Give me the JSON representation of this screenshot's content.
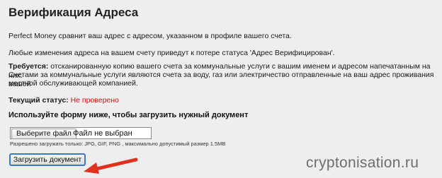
{
  "page": {
    "title": "Верификация Адреса",
    "intro": "Perfect Money сравнит ваш адрес с адресом, указанном в профиле вашего счета.",
    "warning": "Любые изменения адреса на вашем счету приведут к потере статуса 'Адрес Верифицирован'.",
    "required_label": "Требуется:",
    "required_text": "отсканированную копию вашего счета за коммунальные услуги с вашим именем и адресом напечатанным на них.",
    "required_line2": "Счетами за коммунальные услуги являются счета за воду, газ или электричество отправленные на ваш адрес проживания вашей",
    "required_line3": "местной обслуживающей компанией.",
    "status_label": "Текущий статус:",
    "status_value": "Не проверено",
    "form_heading": "Используйте форму ниже, чтобы загрузить нужный документ"
  },
  "upload": {
    "choose_label": "Выберите файл",
    "no_file_label": "Файл не выбран",
    "hint": "Разрешено загружать только: JPG, GIF, PNG , максимально допустимый размер 1.5MB",
    "submit_label": "Загрузить документ"
  },
  "colors": {
    "status_red": "#cc1111",
    "arrow_red": "#e0301e",
    "button_border": "#3b78c8"
  },
  "watermark": "cryptonisation.ru"
}
